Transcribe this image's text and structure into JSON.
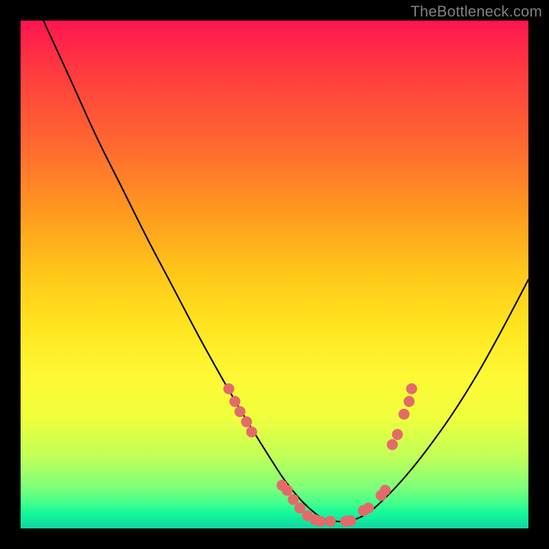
{
  "watermark": "TheBottleneck.com",
  "chart_data": {
    "type": "line",
    "title": "",
    "xlabel": "",
    "ylabel": "",
    "xlim": [
      0,
      100
    ],
    "ylim": [
      0,
      100
    ],
    "series": [
      {
        "name": "curve",
        "color": "#000000",
        "x": [
          4.5,
          10,
          15,
          20,
          25,
          30,
          35,
          40,
          45,
          50,
          52,
          55,
          58,
          60,
          64,
          68,
          72,
          76,
          80,
          85,
          90,
          95,
          100
        ],
        "y": [
          100,
          88,
          77,
          67,
          57,
          47.5,
          38,
          29,
          20.5,
          12.5,
          9.5,
          5.8,
          3.0,
          1.8,
          1.4,
          2.8,
          6.2,
          10.5,
          15.5,
          22.5,
          30.5,
          39.5,
          49
        ]
      }
    ],
    "highlights": {
      "name": "highlight-dots",
      "color": "#e46a6a",
      "points": [
        {
          "x": 41.0,
          "y": 27.5
        },
        {
          "x": 42.2,
          "y": 25.0
        },
        {
          "x": 43.2,
          "y": 23.0
        },
        {
          "x": 44.5,
          "y": 21.0
        },
        {
          "x": 45.5,
          "y": 19.0
        },
        {
          "x": 51.5,
          "y": 8.5
        },
        {
          "x": 52.5,
          "y": 7.5
        },
        {
          "x": 53.7,
          "y": 5.7
        },
        {
          "x": 55.0,
          "y": 4.0
        },
        {
          "x": 56.5,
          "y": 2.5
        },
        {
          "x": 58.0,
          "y": 1.7
        },
        {
          "x": 59.0,
          "y": 1.4
        },
        {
          "x": 61.0,
          "y": 1.4
        },
        {
          "x": 64.0,
          "y": 1.4
        },
        {
          "x": 65.0,
          "y": 1.5
        },
        {
          "x": 67.5,
          "y": 3.5
        },
        {
          "x": 68.5,
          "y": 4.0
        },
        {
          "x": 71.0,
          "y": 6.5
        },
        {
          "x": 71.8,
          "y": 7.5
        },
        {
          "x": 73.2,
          "y": 16.5
        },
        {
          "x": 74.2,
          "y": 18.5
        },
        {
          "x": 75.5,
          "y": 22.5
        },
        {
          "x": 76.5,
          "y": 25.0
        },
        {
          "x": 77.0,
          "y": 27.5
        }
      ]
    }
  }
}
